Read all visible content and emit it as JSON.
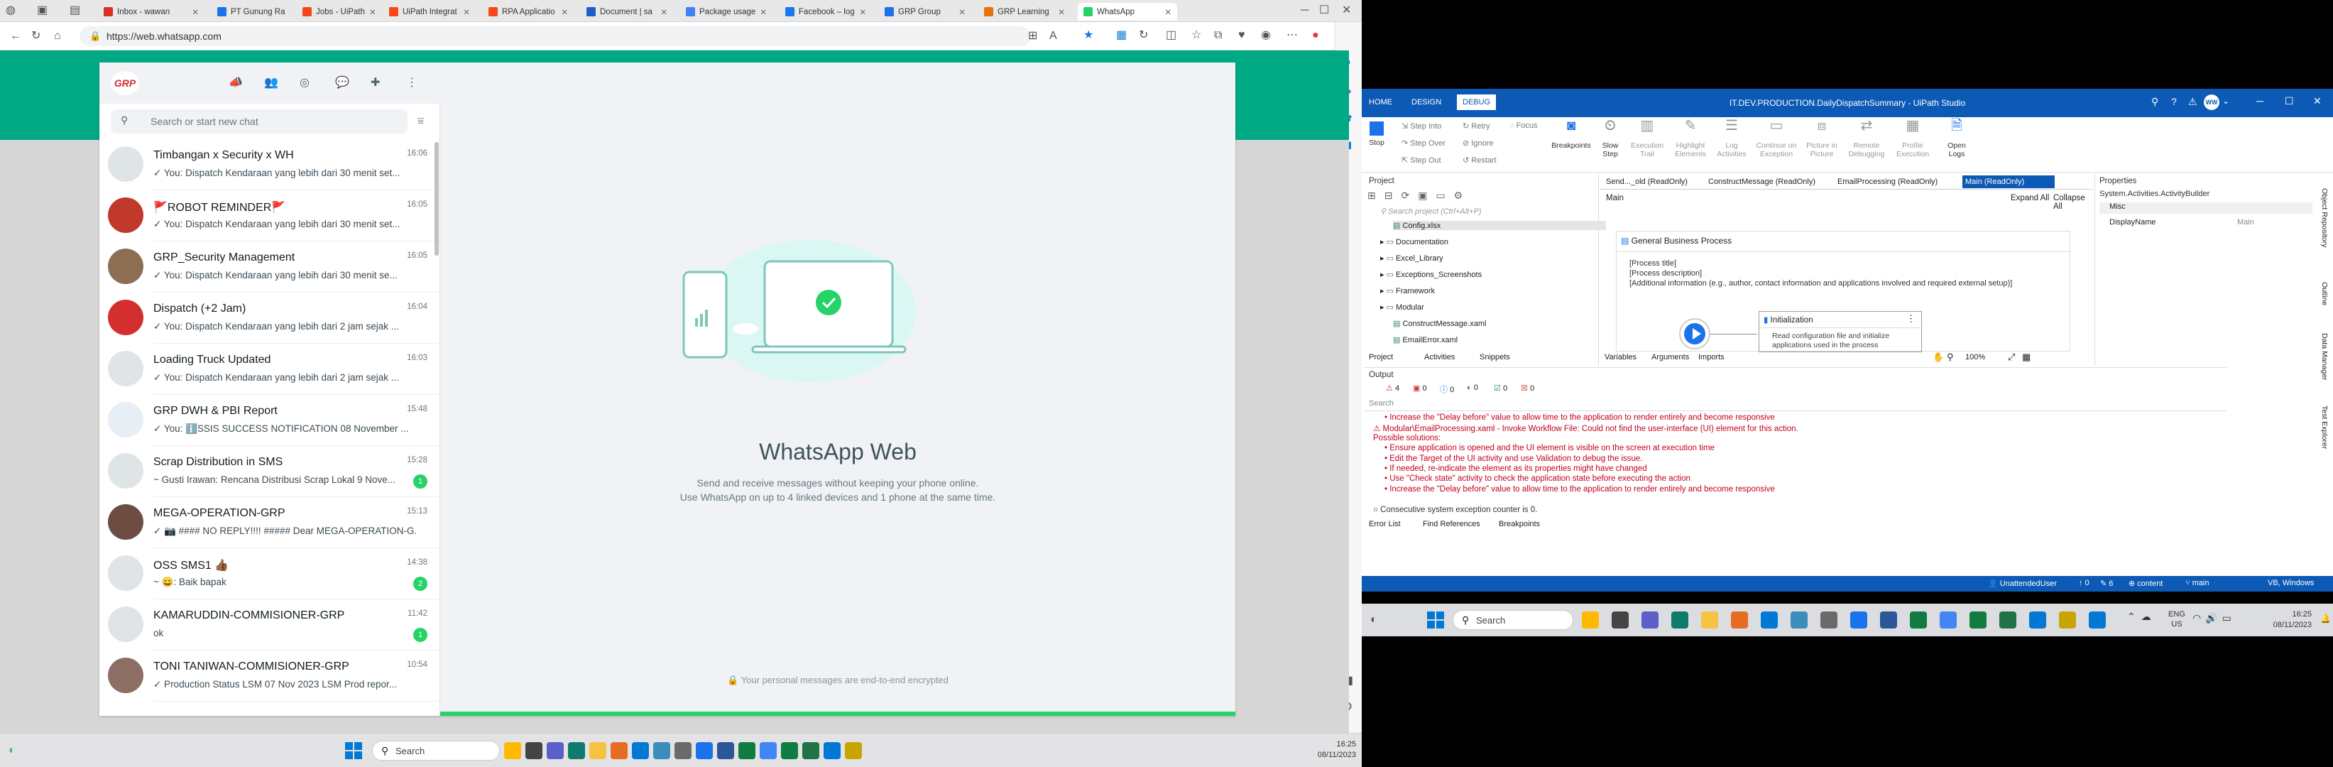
{
  "browser": {
    "tabs": [
      {
        "label": "Inbox - wawan",
        "color": "#d93025"
      },
      {
        "label": "PT Gunung Ra",
        "color": "#1a73e8"
      },
      {
        "label": "Jobs - UiPath",
        "color": "#fa4616"
      },
      {
        "label": "UiPath Integrat",
        "color": "#fa4616"
      },
      {
        "label": "RPA Applicatio",
        "color": "#fa4616"
      },
      {
        "label": "Document | sa",
        "color": "#1e5ec8"
      },
      {
        "label": "Package usage",
        "color": "#3b82f6"
      },
      {
        "label": "Facebook – log",
        "color": "#1877f2"
      },
      {
        "label": "GRP Group",
        "color": "#1a73e8"
      },
      {
        "label": "GRP Learning",
        "color": "#e8710a"
      },
      {
        "label": "WhatsApp",
        "color": "#25d366"
      }
    ],
    "url": "https://web.whatsapp.com"
  },
  "whatsapp": {
    "logo": "GRP",
    "search_placeholder": "Search or start new chat",
    "chats": [
      {
        "name": "Timbangan x Security x WH",
        "time": "16:06",
        "msg": "✓ You: Dispatch Kendaraan yang lebih dari 30 menit set...",
        "avatar": "#dfe5e7",
        "badge": ""
      },
      {
        "name": "🚩ROBOT REMINDER🚩",
        "time": "16:05",
        "msg": "✓ You: Dispatch Kendaraan yang lebih dari 30 menit set...",
        "avatar": "#c0392b",
        "badge": ""
      },
      {
        "name": "GRP_Security Management",
        "time": "16:05",
        "msg": "✓ You: Dispatch Kendaraan yang lebih dari 30 menit se...",
        "avatar": "#8e6e53",
        "badge": ""
      },
      {
        "name": "Dispatch (+2 Jam)",
        "time": "16:04",
        "msg": "✓ You: Dispatch Kendaraan yang lebih dari 2 jam sejak ...",
        "avatar": "#d32f2f",
        "badge": ""
      },
      {
        "name": "Loading Truck Updated",
        "time": "16:03",
        "msg": "✓ You: Dispatch Kendaraan yang lebih dari 2 jam sejak ...",
        "avatar": "#dfe5e7",
        "badge": ""
      },
      {
        "name": "GRP DWH & PBI Report",
        "time": "15:48",
        "msg": "✓ You: ℹ️SSIS SUCCESS NOTIFICATION 08 November ...",
        "avatar": "#e8eef6",
        "badge": ""
      },
      {
        "name": "Scrap Distribution in SMS",
        "time": "15:28",
        "msg": "~ Gusti Irawan: Rencana Distribusi Scrap Lokal 9 Nove...",
        "avatar": "#dfe5e7",
        "badge": "1"
      },
      {
        "name": "MEGA-OPERATION-GRP",
        "time": "15:13",
        "msg": "✓ 📷 #### NO REPLY!!!! ##### Dear MEGA-OPERATION-G...",
        "avatar": "#6d4c41",
        "badge": ""
      },
      {
        "name": "OSS SMS1 👍🏾",
        "time": "14:38",
        "msg": "~ 😄: Baik bapak",
        "avatar": "#dfe5e7",
        "badge": "2"
      },
      {
        "name": "KAMARUDDIN-COMMISIONER-GRP",
        "time": "11:42",
        "msg": "ok",
        "avatar": "#dfe5e7",
        "badge": "1"
      },
      {
        "name": "TONI TANIWAN-COMMISIONER-GRP",
        "time": "10:54",
        "msg": "✓ Production Status LSM 07 Nov 2023   LSM Prod repor...",
        "avatar": "#8d6e63",
        "badge": ""
      }
    ],
    "main_title": "WhatsApp Web",
    "main_sub1": "Send and receive messages without keeping your phone online.",
    "main_sub2": "Use WhatsApp on up to 4 linked devices and 1 phone at the same time.",
    "encrypted": "Your personal messages are end-to-end encrypted"
  },
  "taskbar_left": {
    "search": "Search",
    "time": "16:25",
    "date": "08/11/2023"
  },
  "studio": {
    "title": "IT.DEV.PRODUCTION.DailyDispatchSummary - UiPath Studio",
    "user_initials": "WW",
    "menu": [
      "HOME",
      "DESIGN",
      "DEBUG"
    ],
    "ribbon": {
      "stop": "Stop",
      "step_into": "Step Into",
      "step_over": "Step Over",
      "step_out": "Step Out",
      "retry": "Retry",
      "ignore": "Ignore",
      "restart": "Restart",
      "focus": "Focus",
      "breakpoints": "Breakpoints",
      "slow_step": "Slow Step",
      "execution_trail": "Execution Trail",
      "highlight_elements": "Highlight Elements",
      "log_activities": "Log Activities",
      "continue_on_exception": "Continue on Exception",
      "picture_in_picture": "Picture in Picture",
      "remote_debugging": "Remote Debugging",
      "profile_execution": "Profile Execution",
      "open_logs": "Open Logs"
    },
    "project_label": "Project",
    "project_search": "Search project (Ctrl+Alt+P)",
    "tree": [
      "Config.xlsx",
      "Documentation",
      "Excel_Library",
      "Exceptions_Screenshots",
      "Framework",
      "Modular",
      "ConstructMessage.xaml",
      "EmailError.xaml"
    ],
    "bottom_tabs": [
      "Project",
      "Activities",
      "Snippets"
    ],
    "doc_tabs": [
      "Send..._old (ReadOnly)",
      "ConstructMessage (ReadOnly)",
      "EmailProcessing (ReadOnly)",
      "Main (ReadOnly)"
    ],
    "breadcrumb": "Main",
    "expand_all": "Expand All",
    "collapse_all": "Collapse All",
    "gbp_title": "General Business Process",
    "gbp_lines": [
      "[Process title]",
      "[Process description]",
      "[Additional information (e.g., author, contact information and applications involved and required external setup)]"
    ],
    "init_title": "Initialization",
    "init_desc": "Read configuration file and initialize applications used in the process",
    "var_tabs": [
      "Variables",
      "Arguments",
      "Imports"
    ],
    "zoom": "100%",
    "properties_label": "Properties",
    "properties_type": "System.Activities.ActivityBuilder",
    "misc": "Misc",
    "display_name_label": "DisplayName",
    "display_name_value": "Main",
    "side_tabs": [
      "Object Repository",
      "Outline",
      "Data Manager",
      "Test Explorer"
    ],
    "output_label": "Output",
    "output_counts": [
      "4",
      "0",
      "0",
      "0",
      "0",
      "0"
    ],
    "output_search": "Search",
    "output_lines": [
      "•  Increase the \"Delay before\" value to allow time to the application to render entirely and become responsive",
      "⚠ Modular\\EmailProcessing.xaml - Invoke Workflow File: Could not find the user-interface (UI) element for this action.",
      "   Possible solutions:",
      "•  Ensure application is opened and the UI element is visible on the screen at execution time",
      "•  Edit the Target of the UI activity and use Validation to debug the issue.",
      "•  If needed, re-indicate the element as its properties might have changed",
      "•  Use \"Check state\" activity to check the application state before executing the action",
      "•  Increase the \"Delay before\" value to allow time to the application to render entirely and become responsive"
    ],
    "output_last": "Consecutive system exception counter is 0.",
    "output_tabs": [
      "Error List",
      "Find References",
      "Breakpoints"
    ],
    "status_user": "UnattendedUser",
    "status_items": [
      "0",
      "6",
      "content",
      "main",
      "VB, Windows"
    ]
  },
  "taskbar_right": {
    "search": "Search",
    "lang1": "ENG",
    "lang2": "US",
    "time": "16:25",
    "date": "08/11/2023"
  }
}
